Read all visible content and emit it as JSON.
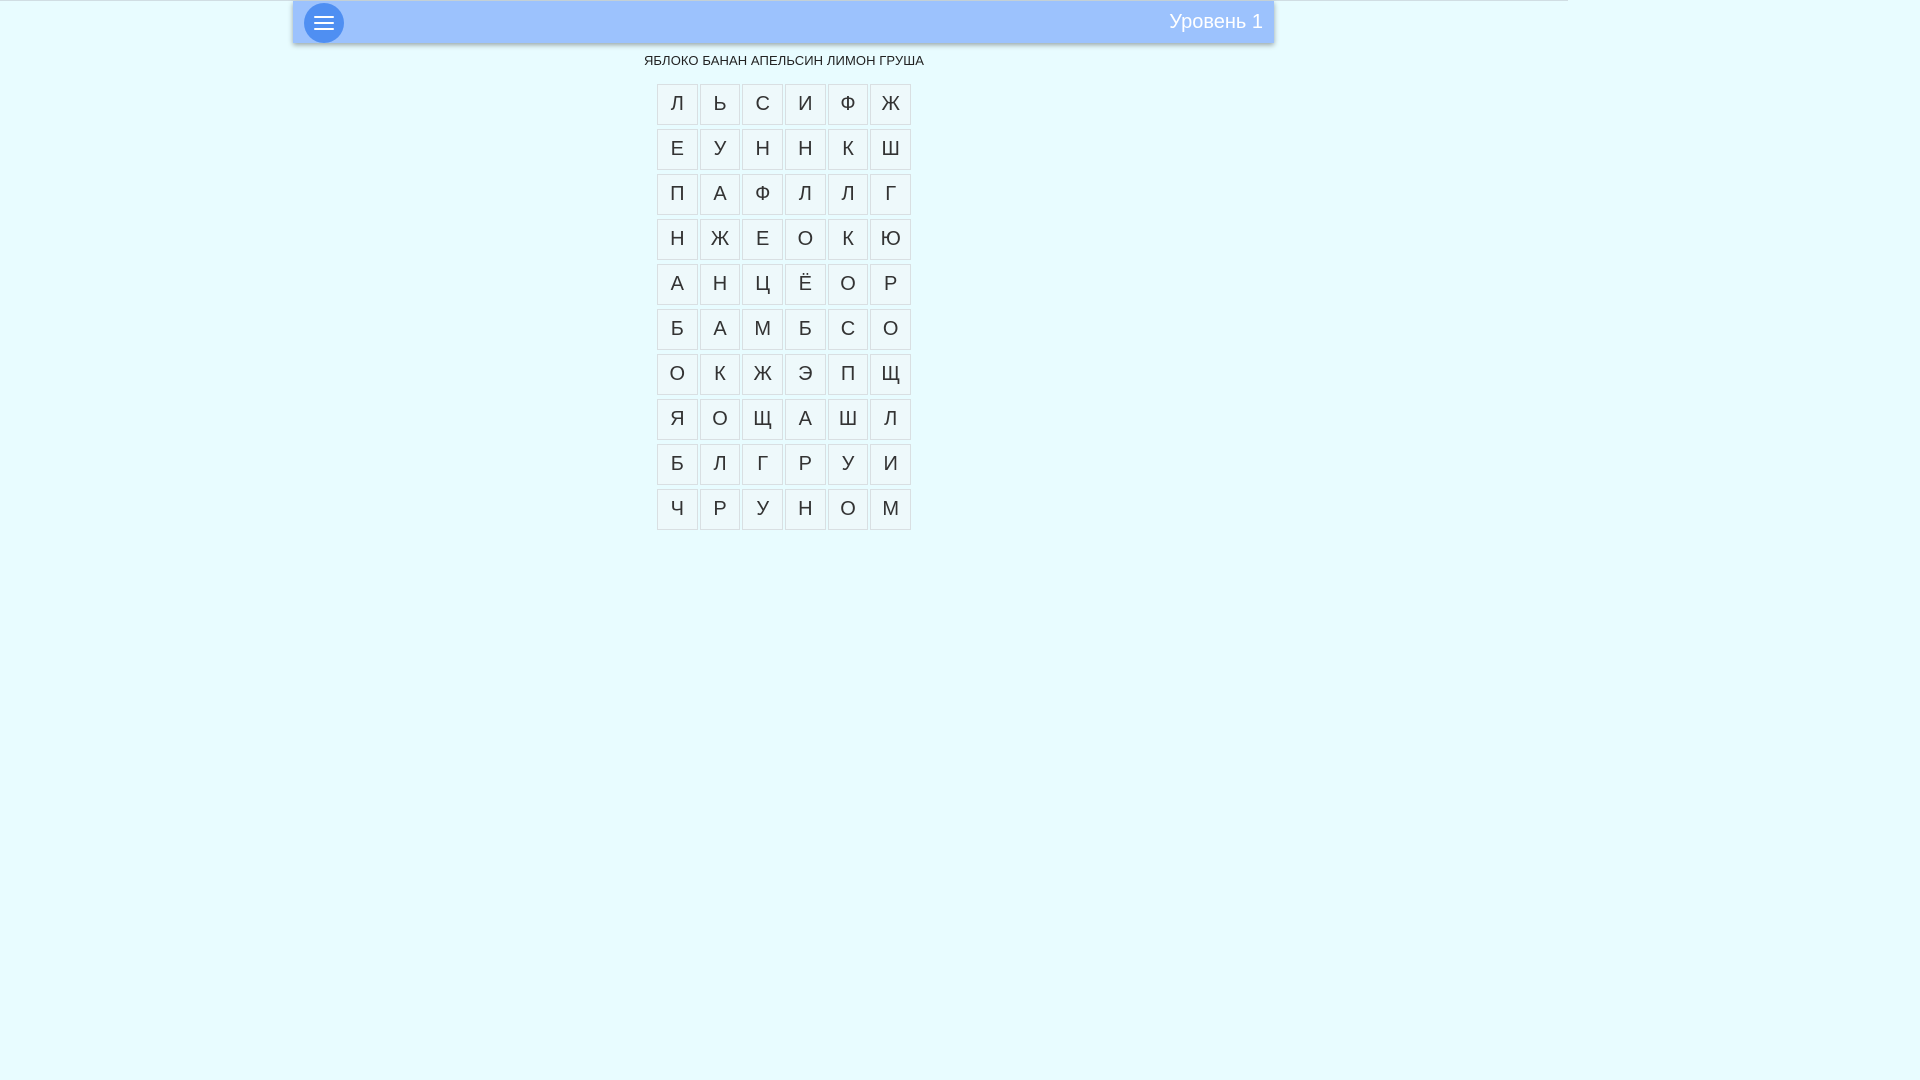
{
  "header": {
    "level_label": "Уровень 1"
  },
  "words_line": "ЯБЛОКО БАНАН АПЕЛЬСИН ЛИМОН ГРУША",
  "grid": [
    [
      "Л",
      "Ь",
      "С",
      "И",
      "Ф",
      "Ж"
    ],
    [
      "Е",
      "У",
      "Н",
      "Н",
      "К",
      "Ш"
    ],
    [
      "П",
      "А",
      "Ф",
      "Л",
      "Л",
      "Г"
    ],
    [
      "Н",
      "Ж",
      "Е",
      "О",
      "К",
      "Ю"
    ],
    [
      "А",
      "Н",
      "Ц",
      "Ё",
      "О",
      "Р"
    ],
    [
      "Б",
      "А",
      "М",
      "Б",
      "С",
      "О"
    ],
    [
      "О",
      "К",
      "Ж",
      "Э",
      "П",
      "Щ"
    ],
    [
      "Я",
      "О",
      "Щ",
      "А",
      "Ш",
      "Л"
    ],
    [
      "Б",
      "Л",
      "Г",
      "Р",
      "У",
      "И"
    ],
    [
      "Ч",
      "Р",
      "У",
      "Н",
      "О",
      "М"
    ]
  ],
  "colors": {
    "background": "#e8fcff",
    "header": "#9cc2fd",
    "menu_button": "#4f8ff2"
  }
}
